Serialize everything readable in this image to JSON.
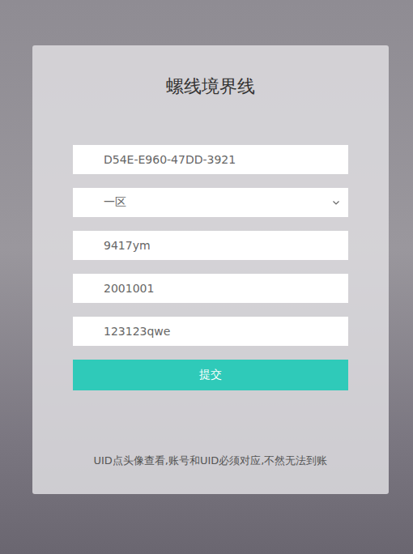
{
  "form": {
    "title": "螺线境界线",
    "fields": [
      {
        "kind": "text",
        "value": "D54E-E960-47DD-3921"
      },
      {
        "kind": "select",
        "value": "一区"
      },
      {
        "kind": "text",
        "value": "9417ym"
      },
      {
        "kind": "text",
        "value": "2001001"
      },
      {
        "kind": "text",
        "value": "123123qwe"
      }
    ],
    "submit": "提交",
    "note": "UID点头像查看,账号和UID必须对应,不然无法到账"
  }
}
